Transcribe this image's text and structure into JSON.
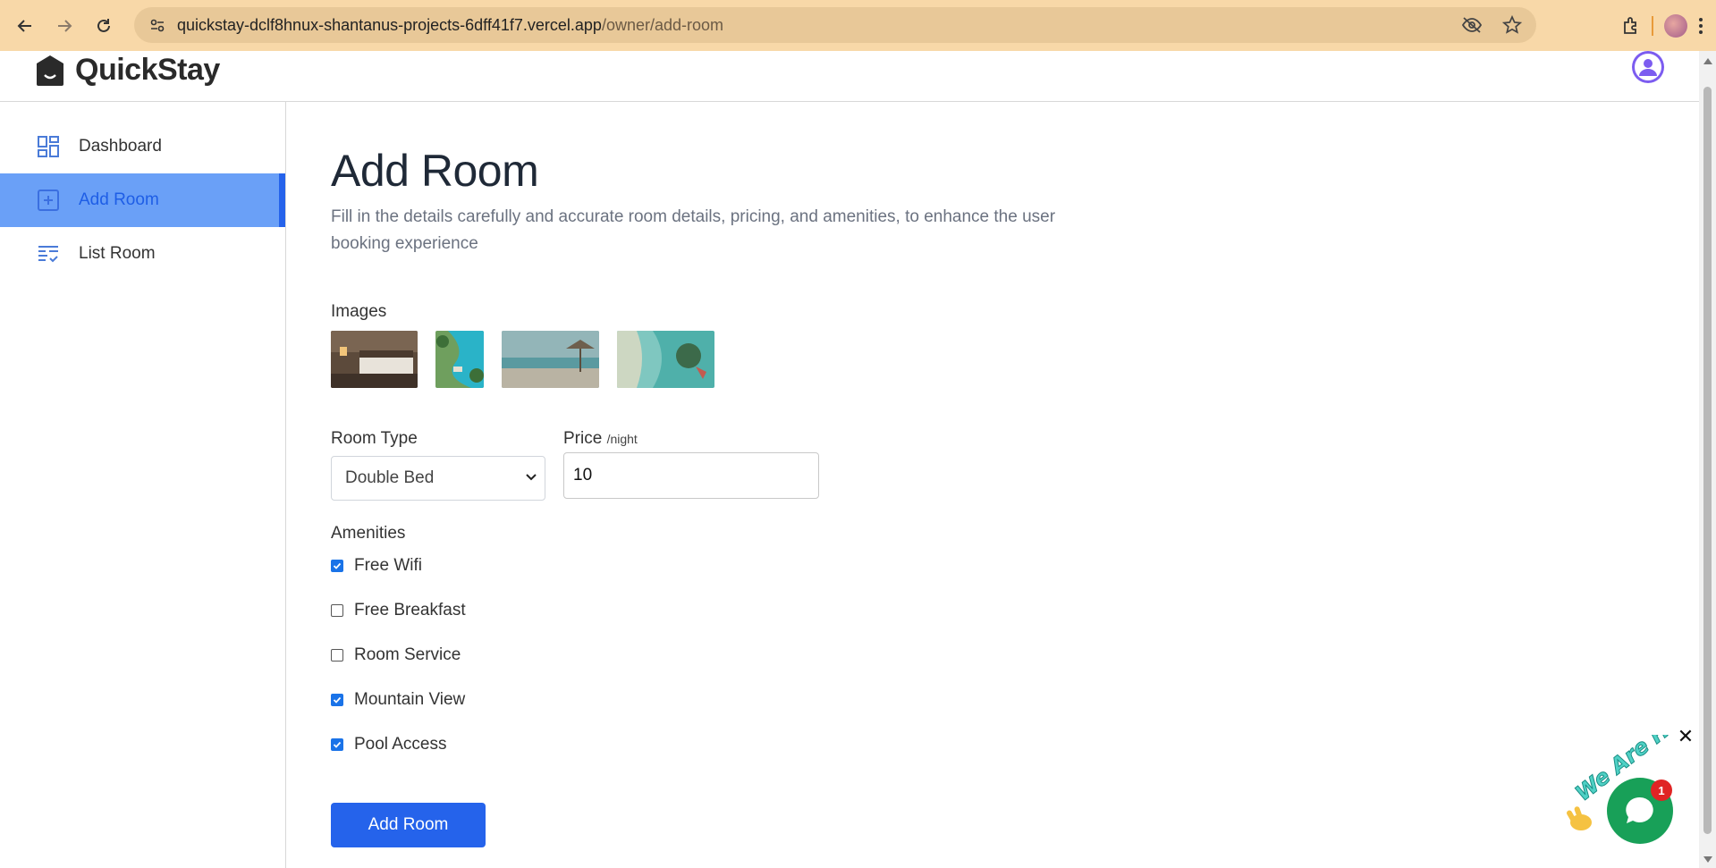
{
  "browser": {
    "url_host": "quickstay-dclf8hnux-shantanus-projects-6dff41f7.vercel.app",
    "url_path": "/owner/add-room"
  },
  "header": {
    "logo_text": "QuickStay"
  },
  "sidebar": {
    "items": [
      {
        "label": "Dashboard",
        "icon": "dashboard-icon"
      },
      {
        "label": "Add Room",
        "icon": "add-square-icon",
        "active": true
      },
      {
        "label": "List Room",
        "icon": "list-icon"
      }
    ]
  },
  "main": {
    "title": "Add Room",
    "subtitle": "Fill in the details carefully and accurate room details, pricing, and amenities, to enhance the user booking experience",
    "images_label": "Images",
    "images": [
      {
        "alt": "hotel-bedroom"
      },
      {
        "alt": "resort-pool-aerial"
      },
      {
        "alt": "beach-umbrella"
      },
      {
        "alt": "coast-aerial"
      }
    ],
    "room_type": {
      "label": "Room Type",
      "value": "Double Bed"
    },
    "price": {
      "label": "Price",
      "unit": "/night",
      "value": "10"
    },
    "amenities_label": "Amenities",
    "amenities": [
      {
        "label": "Free Wifi",
        "checked": true
      },
      {
        "label": "Free Breakfast",
        "checked": false
      },
      {
        "label": "Room Service",
        "checked": false
      },
      {
        "label": "Mountain View",
        "checked": true
      },
      {
        "label": "Pool Access",
        "checked": true
      }
    ],
    "submit_label": "Add Room"
  },
  "chat_widget": {
    "banner_text": "We Are Here!",
    "badge_count": "1"
  },
  "colors": {
    "accent": "#2563eb",
    "sidebar_active_bg": "#6aa0f7",
    "browser_bar": "#f8d8a8",
    "chat_green": "#18a058"
  }
}
